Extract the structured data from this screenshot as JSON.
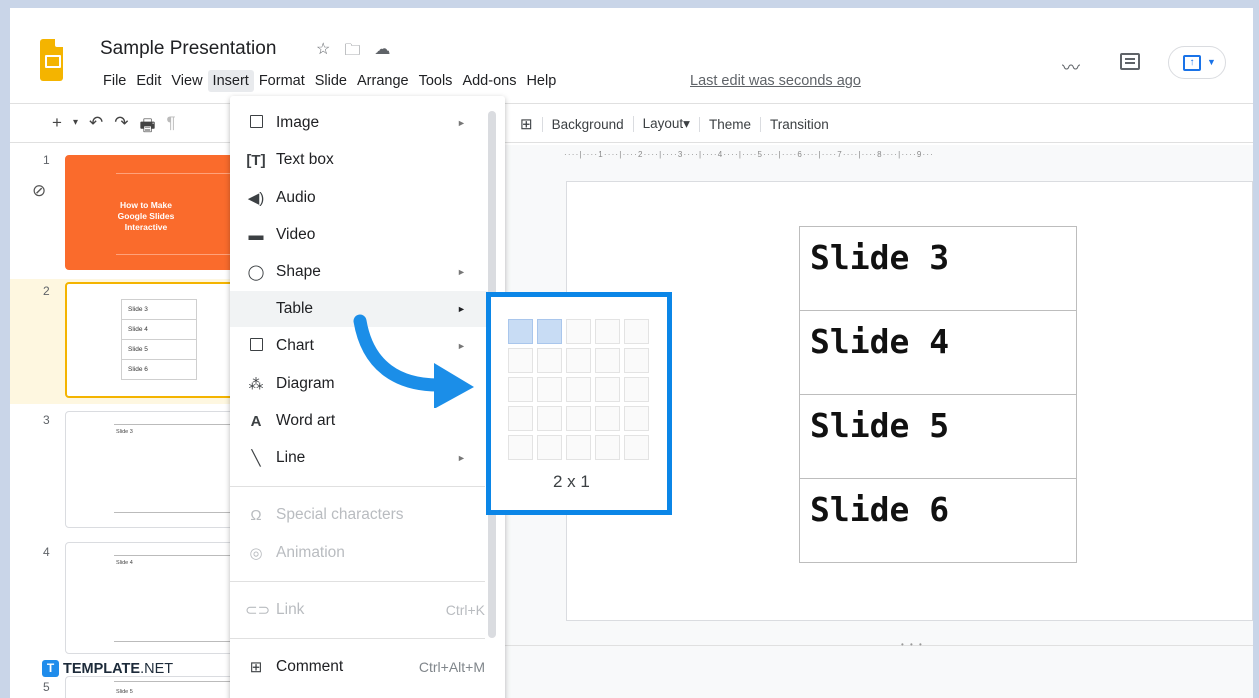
{
  "app": {
    "doc_title": "Sample Presentation",
    "menubar": [
      "File",
      "Edit",
      "View",
      "Insert",
      "Format",
      "Slide",
      "Arrange",
      "Tools",
      "Add-ons",
      "Help"
    ],
    "last_edit": "Last edit was seconds ago"
  },
  "toolbar": {
    "background": "Background",
    "layout": "Layout▾",
    "theme": "Theme",
    "transition": "Transition"
  },
  "filmstrip": {
    "slides": [
      {
        "number": "1",
        "text": "How to Make Google Slides Interactive"
      },
      {
        "number": "2",
        "rows": [
          "Slide 3",
          "Slide 4",
          "Slide 5",
          "Slide 6"
        ]
      },
      {
        "number": "3",
        "caption": "Slide 3"
      },
      {
        "number": "4",
        "caption": "Slide 4"
      },
      {
        "number": "5",
        "caption": "Slide 5"
      }
    ]
  },
  "ruler": "····|····1····|····2····|····3····|····4····|····5····|····6····|····7····|····8····|····9···",
  "slide_table": [
    "Slide 3",
    "Slide 4",
    "Slide 5",
    "Slide 6"
  ],
  "insert_menu": {
    "items": [
      {
        "label": "Image",
        "icon": "image-icon",
        "submenu": true
      },
      {
        "label": "Text box",
        "icon": "text-box-icon"
      },
      {
        "label": "Audio",
        "icon": "audio-icon"
      },
      {
        "label": "Video",
        "icon": "video-icon"
      },
      {
        "label": "Shape",
        "icon": "shape-icon",
        "submenu": true
      },
      {
        "label": "Table",
        "icon": "table-icon",
        "submenu": true,
        "highlighted": true
      },
      {
        "label": "Chart",
        "icon": "chart-icon",
        "submenu": true
      },
      {
        "label": "Diagram",
        "icon": "diagram-icon"
      },
      {
        "label": "Word art",
        "icon": "word-art-icon"
      },
      {
        "label": "Line",
        "icon": "line-icon",
        "submenu": true
      },
      {
        "label": "Special characters",
        "icon": "omega-icon",
        "disabled": true
      },
      {
        "label": "Animation",
        "icon": "animation-icon",
        "disabled": true
      },
      {
        "label": "Link",
        "icon": "link-icon",
        "shortcut": "Ctrl+K",
        "disabled": true
      },
      {
        "label": "Comment",
        "icon": "comment-icon",
        "shortcut": "Ctrl+Alt+M"
      }
    ]
  },
  "table_picker": {
    "size_label": "2 x 1",
    "selected_cols": 2,
    "selected_rows": 1
  },
  "watermark": {
    "brand": "TEMPLATE",
    "suffix": ".NET"
  },
  "colors": {
    "accent_blue": "#0b86e7",
    "slides_yellow": "#f4b400",
    "title_slide_orange": "#fa6b2c"
  }
}
